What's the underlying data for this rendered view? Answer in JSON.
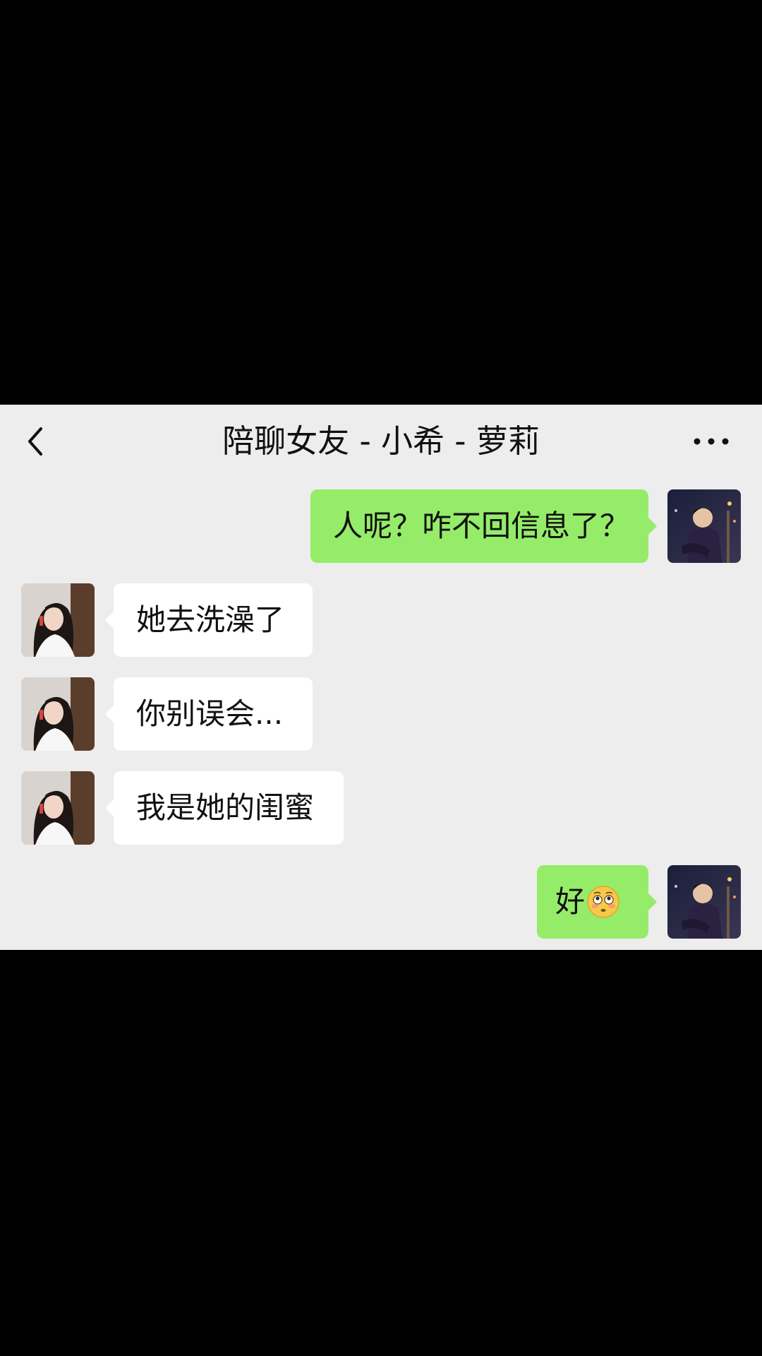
{
  "header": {
    "title": "陪聊女友 - 小希 - 萝莉",
    "back_icon": "chevron-left-icon",
    "more_icon": "ellipsis-icon"
  },
  "messages": [
    {
      "side": "right",
      "sender": "me",
      "text": "人呢？咋不回信息了？"
    },
    {
      "side": "left",
      "sender": "contact",
      "text": "她去洗澡了"
    },
    {
      "side": "left",
      "sender": "contact",
      "text": "你别误会..."
    },
    {
      "side": "left",
      "sender": "contact",
      "text": "我是她的闺蜜"
    },
    {
      "side": "right",
      "sender": "me",
      "text": "好",
      "emoji": "flushed-face-emoji"
    }
  ],
  "colors": {
    "outside": "#000000",
    "chat_background": "#EDEDED",
    "sent_bubble": "#95EC69",
    "received_bubble": "#FFFFFF",
    "text": "#111111"
  }
}
